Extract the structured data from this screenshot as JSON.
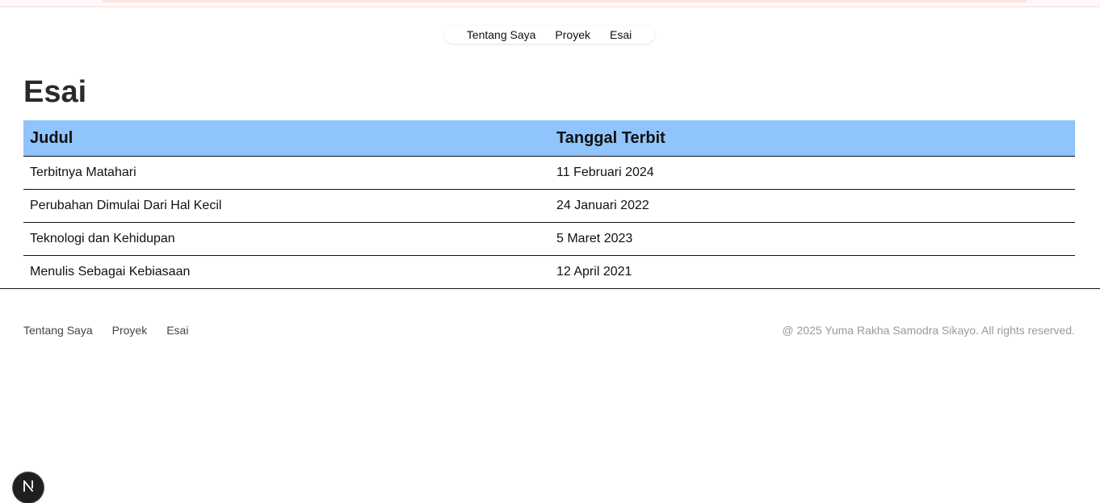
{
  "top_nav": {
    "items": [
      "Tentang Saya",
      "Proyek",
      "Esai"
    ]
  },
  "page": {
    "title": "Esai"
  },
  "table": {
    "headers": [
      "Judul",
      "Tanggal Terbit"
    ],
    "rows": [
      [
        "Terbitnya Matahari",
        "11 Februari 2024"
      ],
      [
        "Perubahan Dimulai Dari Hal Kecil",
        "24 Januari 2022"
      ],
      [
        "Teknologi dan Kehidupan",
        "5 Maret 2023"
      ],
      [
        "Menulis Sebagai Kebiasaan",
        "12 April 2021"
      ]
    ]
  },
  "footer": {
    "nav": [
      "Tentang Saya",
      "Proyek",
      "Esai"
    ],
    "copyright": "@ 2025 Yuma Rakha Samodra Sikayo. All rights reserved."
  },
  "colors": {
    "table_header_bg": "#90c4fc",
    "accent_banner": "#fde4e4"
  },
  "icons": {
    "dev_badge": "nextjs-logo-icon"
  }
}
